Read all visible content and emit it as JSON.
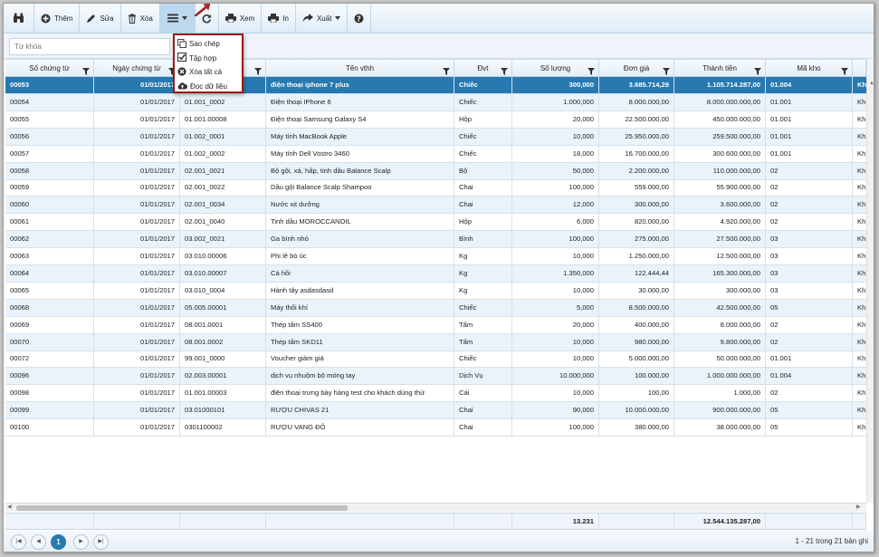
{
  "toolbar": {
    "add_label": "Thêm",
    "edit_label": "Sửa",
    "delete_label": "Xóa",
    "view_label": "Xem",
    "print_label": "In",
    "export_label": "Xuất"
  },
  "menu": {
    "items": [
      "Sao chép",
      "Tập hợp",
      "Xóa tất cả",
      "Đọc dữ liệu"
    ]
  },
  "search": {
    "placeholder": "Từ khóa"
  },
  "columns": [
    "Số chứng từ",
    "Ngày chứng từ",
    "",
    "Tên vthh",
    "Đvt",
    "Số lượng",
    "Đơn giá",
    "Thành tiền",
    "Mã kho",
    ""
  ],
  "rows": [
    [
      "00053",
      "01/01/2017",
      "",
      "điện thoại iphone 7 plus",
      "Chiếc",
      "300,000",
      "3.685.714,29",
      "1.105.714.287,00",
      "01.004",
      "Kh"
    ],
    [
      "00054",
      "01/01/2017",
      "01.001_0002",
      "Điện thoại IPhone 6",
      "Chiếc",
      "1.000,000",
      "8.000.000,00",
      "8.000.000.000,00",
      "01.001",
      "Kh"
    ],
    [
      "00055",
      "01/01/2017",
      "01.001.00008",
      "Điện thoại Samsung Galaxy S4",
      "Hộp",
      "20,000",
      "22.500.000,00",
      "450.000.000,00",
      "01.001",
      "Kh"
    ],
    [
      "00056",
      "01/01/2017",
      "01.002_0001",
      "Máy tính MacBook Apple",
      "Chiếc",
      "10,000",
      "25.950.000,00",
      "259.500.000,00",
      "01.001",
      "Kh"
    ],
    [
      "00057",
      "01/01/2017",
      "01.002_0002",
      "Máy tính Dell Vostro 3460",
      "Chiếc",
      "18,000",
      "16.700.000,00",
      "300.600.000,00",
      "01.001",
      "Kh"
    ],
    [
      "00058",
      "01/01/2017",
      "02.001_0021",
      "Bộ gội, xả, hấp, tinh dầu Balance Scalp",
      "Bộ",
      "50,000",
      "2.200.000,00",
      "110.000.000,00",
      "02",
      "Kh"
    ],
    [
      "00059",
      "01/01/2017",
      "02.001_0022",
      "Dầu gội Balance Scalp Shampoo",
      "Chai",
      "100,000",
      "559.000,00",
      "55.900.000,00",
      "02",
      "Kh"
    ],
    [
      "00060",
      "01/01/2017",
      "02.001_0034",
      "Nước xịt dưỡng",
      "Chai",
      "12,000",
      "300.000,00",
      "3.600.000,00",
      "02",
      "Kh"
    ],
    [
      "00061",
      "01/01/2017",
      "02.001_0040",
      "Tinh dầu MOROCCANOIL",
      "Hộp",
      "6,000",
      "820.000,00",
      "4.920.000,00",
      "02",
      "Kh"
    ],
    [
      "00062",
      "01/01/2017",
      "03.002_0021",
      "Ga bình nhỏ",
      "Bình",
      "100,000",
      "275.000,00",
      "27.500.000,00",
      "03",
      "Kh"
    ],
    [
      "00063",
      "01/01/2017",
      "03.010.00006",
      "Phi lê bò úc",
      "Kg",
      "10,000",
      "1.250.000,00",
      "12.500.000,00",
      "03",
      "Kh"
    ],
    [
      "00064",
      "01/01/2017",
      "03.010.00007",
      "Cá hồi",
      "Kg",
      "1.350,000",
      "122.444,44",
      "165.300.000,00",
      "03",
      "Kh"
    ],
    [
      "00065",
      "01/01/2017",
      "03.010_0004",
      "Hành tây asdasdasd",
      "Kg",
      "10,000",
      "30.000,00",
      "300.000,00",
      "03",
      "Kh"
    ],
    [
      "00068",
      "01/01/2017",
      "05.005.00001",
      "Máy thổi khí",
      "Chiếc",
      "5,000",
      "8.500.000,00",
      "42.500.000,00",
      "05",
      "Kh"
    ],
    [
      "00069",
      "01/01/2017",
      "08.001.0001",
      "Thép tấm SS400",
      "Tấm",
      "20,000",
      "400.000,00",
      "8.000.000,00",
      "02",
      "Kh"
    ],
    [
      "00070",
      "01/01/2017",
      "08.001.0002",
      "Thép tấm SKD11",
      "Tấm",
      "10,000",
      "980.000,00",
      "9.800.000,00",
      "02",
      "Kh"
    ],
    [
      "00072",
      "01/01/2017",
      "99.001_0000",
      "Voucher giảm giá",
      "Chiếc",
      "10,000",
      "5.000.000,00",
      "50.000.000,00",
      "01.001",
      "Kh"
    ],
    [
      "00096",
      "01/01/2017",
      "02.003.00001",
      "dịch vụ nhuộm bộ móng tay",
      "Dịch Vụ",
      "10.000,000",
      "100.000,00",
      "1.000.000.000,00",
      "01.004",
      "Kh"
    ],
    [
      "00098",
      "01/01/2017",
      "01.001.00003",
      "điện thoại trưng bày hàng test cho khách dùng thử",
      "Cái",
      "10,000",
      "100,00",
      "1.000,00",
      "02",
      "Kh"
    ],
    [
      "00099",
      "01/01/2017",
      "03.01000101",
      "RƯỢU CHIVAS 21",
      "Chai",
      "90,000",
      "10.000.000,00",
      "900.000.000,00",
      "05",
      "Kh"
    ],
    [
      "00100",
      "01/01/2017",
      "0301100002",
      "RƯỢU VANG ĐỎ",
      "Chai",
      "100,000",
      "380.000,00",
      "38.000.000,00",
      "05",
      "Kh"
    ]
  ],
  "totals": {
    "quantity": "13.231",
    "amount": "12.544.135.287,00"
  },
  "pager": {
    "current": "1",
    "info": "1 - 21 trong 21 bản ghi"
  },
  "colors": {
    "selected_row": "#2779b0",
    "menu_border": "#9c1a1a",
    "accent": "#2779b0"
  }
}
